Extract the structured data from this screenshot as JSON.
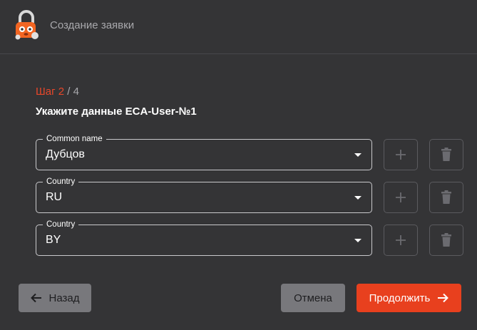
{
  "header": {
    "title": "Создание заявки",
    "logo_icon": "padlock-mascot-icon"
  },
  "step": {
    "current": "Шаг 2",
    "separator": " / ",
    "total": "4"
  },
  "subtitle": "Укажите данные ECA-User-№1",
  "fields": [
    {
      "label": "Common name",
      "value": "Дубцов"
    },
    {
      "label": "Country",
      "value": "RU"
    },
    {
      "label": "Country",
      "value": "BY"
    }
  ],
  "buttons": {
    "back": "Назад",
    "cancel": "Отмена",
    "next": "Продолжить"
  },
  "colors": {
    "accent": "#e8401e",
    "background": "#343436",
    "secondary_button": "#78787c"
  }
}
